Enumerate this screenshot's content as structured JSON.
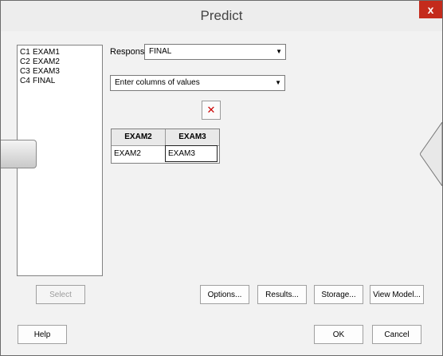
{
  "window": {
    "title": "Predict",
    "close_label": "x"
  },
  "variables": [
    {
      "col": "C1",
      "name": "EXAM1"
    },
    {
      "col": "C2",
      "name": "EXAM2"
    },
    {
      "col": "C3",
      "name": "EXAM3"
    },
    {
      "col": "C4",
      "name": "FINAL"
    }
  ],
  "response": {
    "label": "Response:",
    "value": "FINAL"
  },
  "entry_mode": {
    "value": "Enter columns of values"
  },
  "delete_label": "✕",
  "grid": {
    "headers": [
      "EXAM2",
      "EXAM3"
    ],
    "row": [
      "EXAM2",
      "EXAM3"
    ]
  },
  "buttons": {
    "select": "Select",
    "options": "Options...",
    "results": "Results...",
    "storage": "Storage...",
    "view_model": "View Model...",
    "help": "Help",
    "ok": "OK",
    "cancel": "Cancel"
  },
  "colors": {
    "close": "#c42b1c",
    "delete": "#cc0000"
  }
}
